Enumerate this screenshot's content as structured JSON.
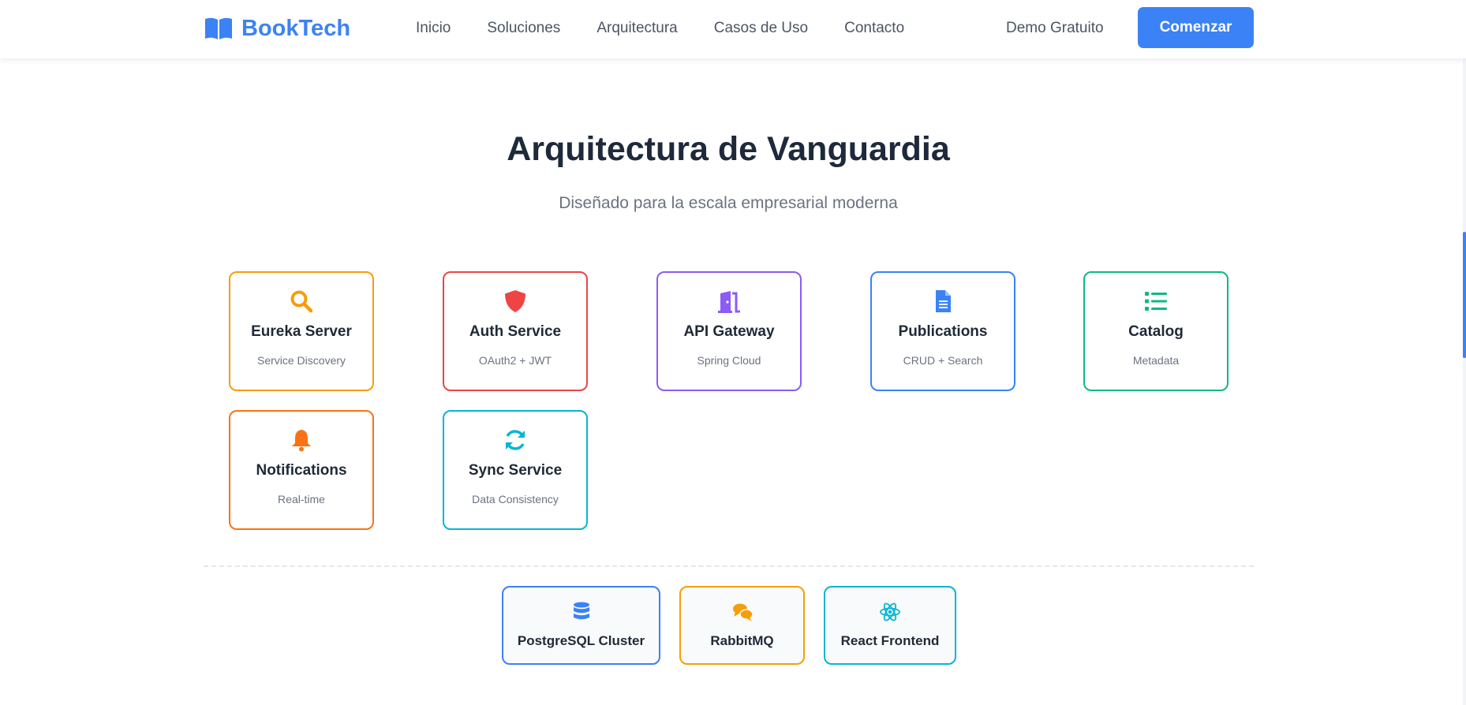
{
  "nav": {
    "logo_text": "BookTech",
    "logo_icon": "book-open-icon",
    "links": [
      "Inicio",
      "Soluciones",
      "Arquitectura",
      "Casos de Uso",
      "Contacto"
    ],
    "demo_label": "Demo Gratuito",
    "cta_label": "Comenzar"
  },
  "section": {
    "title": "Arquitectura de Vanguardia",
    "subtitle": "Diseñado para la escala empresarial moderna"
  },
  "services": [
    {
      "name": "Eureka Server",
      "desc": "Service Discovery",
      "icon": "search-icon",
      "color": "#f59e0b"
    },
    {
      "name": "Auth Service",
      "desc": "OAuth2 + JWT",
      "icon": "shield-icon",
      "color": "#ef4444"
    },
    {
      "name": "API Gateway",
      "desc": "Spring Cloud",
      "icon": "door-icon",
      "color": "#8b5cf6"
    },
    {
      "name": "Publications",
      "desc": "CRUD + Search",
      "icon": "document-icon",
      "color": "#3b82f6"
    },
    {
      "name": "Catalog",
      "desc": "Metadata",
      "icon": "list-icon",
      "color": "#10b981"
    },
    {
      "name": "Notifications",
      "desc": "Real-time",
      "icon": "bell-icon",
      "color": "#f97316"
    },
    {
      "name": "Sync Service",
      "desc": "Data Consistency",
      "icon": "sync-icon",
      "color": "#06b6d4"
    }
  ],
  "infrastructure": [
    {
      "name": "PostgreSQL Cluster",
      "icon": "database-icon",
      "color": "#3b82f6"
    },
    {
      "name": "RabbitMQ",
      "icon": "chat-icon",
      "color": "#f59e0b"
    },
    {
      "name": "React Frontend",
      "icon": "react-icon",
      "color": "#06b6d4"
    }
  ],
  "theme": {
    "accent": "#3b82f6",
    "title_color": "#1e293b",
    "muted_text": "#6b7280"
  }
}
